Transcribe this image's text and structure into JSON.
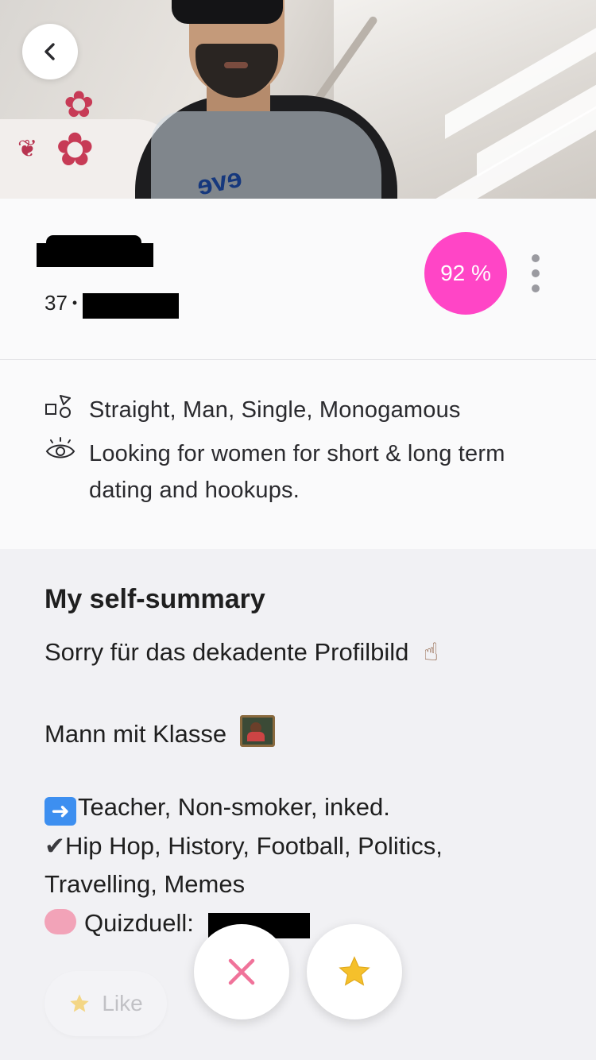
{
  "profile": {
    "age": "37",
    "separator": "•",
    "match_percent": "92 %",
    "photo_brand_text": "eve"
  },
  "details": {
    "identity": "Straight, Man, Single, Monogamous",
    "looking_for_line1": "Looking for women for short & long term",
    "looking_for_line2": "dating and hookups."
  },
  "summary": {
    "title": "My self-summary",
    "line1": "Sorry für das dekadente Profilbild",
    "line2": "Mann mit Klasse",
    "line3": "Teacher, Non-smoker, inked.",
    "line4": "Hip Hop, History, Football, Politics,",
    "line5": "Travelling, Memes",
    "line6": "Quizduell:"
  },
  "actions": {
    "like_label": "Like"
  },
  "colors": {
    "match_badge": "#ff45c6",
    "pass_x": "#f0739a",
    "star": "#f5c02b"
  },
  "icons": {
    "back": "chevron-left-icon",
    "more": "more-vertical-icon",
    "identity": "shapes-icon",
    "looking_for": "eye-icon",
    "pass": "close-icon",
    "superlike": "star-icon",
    "like": "star-icon"
  }
}
